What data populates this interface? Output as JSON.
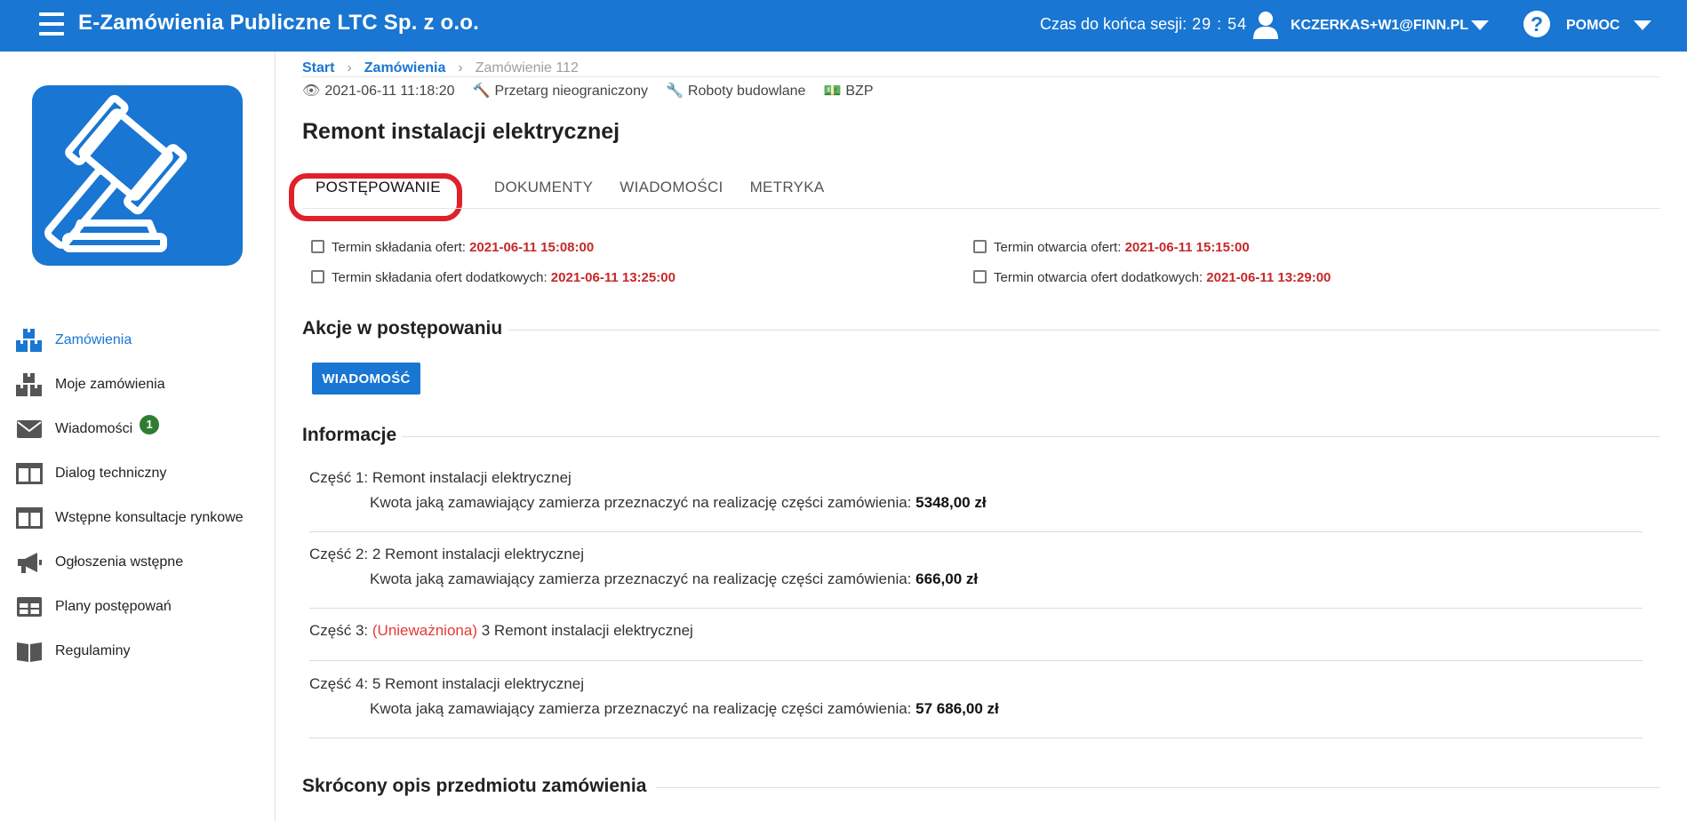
{
  "header": {
    "title": "E-Zamówienia Publiczne LTC Sp. z o.o.",
    "session_label": "Czas do końca sesji:",
    "session_time": "29 : 54",
    "user": "KCZERKAS+W1@FINN.PL",
    "help": "POMOC",
    "icons": {
      "menu": "hamburger-icon",
      "user": "user-icon",
      "help": "help-icon"
    }
  },
  "sidebar": {
    "logo_icon": "gavel-icon",
    "items": [
      {
        "label": "Zamówienia",
        "icon": "boxes-icon",
        "active": true
      },
      {
        "label": "Moje zamówienia",
        "icon": "boxes-icon"
      },
      {
        "label": "Wiadomości",
        "icon": "envelope-icon",
        "badge": "1"
      },
      {
        "label": "Dialog techniczny",
        "icon": "columns-icon"
      },
      {
        "label": "Wstępne konsultacje rynkowe",
        "icon": "columns-icon"
      },
      {
        "label": "Ogłoszenia wstępne",
        "icon": "megaphone-icon"
      },
      {
        "label": "Plany postępowań",
        "icon": "table-icon"
      },
      {
        "label": "Regulaminy",
        "icon": "book-icon"
      }
    ]
  },
  "breadcrumb": {
    "start": "Start",
    "orders": "Zamówienia",
    "current": "Zamówienie 112"
  },
  "meta": {
    "date": "2021-06-11 11:18:20",
    "mode": "Przetarg nieograniczony",
    "category": "Roboty budowlane",
    "source": "BZP"
  },
  "page_title": "Remont instalacji elektrycznej",
  "tabs": [
    "POSTĘPOWANIE",
    "DOKUMENTY",
    "WIADOMOŚCI",
    "METRYKA"
  ],
  "dates": {
    "offers_label": "Termin składania ofert:",
    "offers_value": "2021-06-11 15:08:00",
    "extra_offers_label": "Termin składania ofert dodatkowych:",
    "extra_offers_value": "2021-06-11 13:25:00",
    "opening_label": "Termin otwarcia ofert:",
    "opening_value": "2021-06-11 15:15:00",
    "extra_opening_label": "Termin otwarcia ofert dodatkowych:",
    "extra_opening_value": "2021-06-11 13:29:00"
  },
  "actions": {
    "title": "Akcje w postępowaniu",
    "message_button": "WIADOMOŚĆ"
  },
  "info": {
    "title": "Informacje",
    "amount_label": "Kwota jaką zamawiający zamierza przeznaczyć na realizację części zamówienia:",
    "parts": [
      {
        "label": "Część 1:",
        "name": "Remont instalacji elektrycznej",
        "amount": "5348,00 zł"
      },
      {
        "label": "Część 2:",
        "name": "2 Remont instalacji elektrycznej",
        "amount": "666,00 zł"
      },
      {
        "label": "Część 3:",
        "status": "(Unieważniona)",
        "name": "3 Remont instalacji elektrycznej"
      },
      {
        "label": "Część 4:",
        "name": "5 Remont instalacji elektrycznej",
        "amount": "57 686,00 zł"
      }
    ]
  },
  "description": {
    "title": "Skrócony opis przedmiotu zamówienia"
  }
}
